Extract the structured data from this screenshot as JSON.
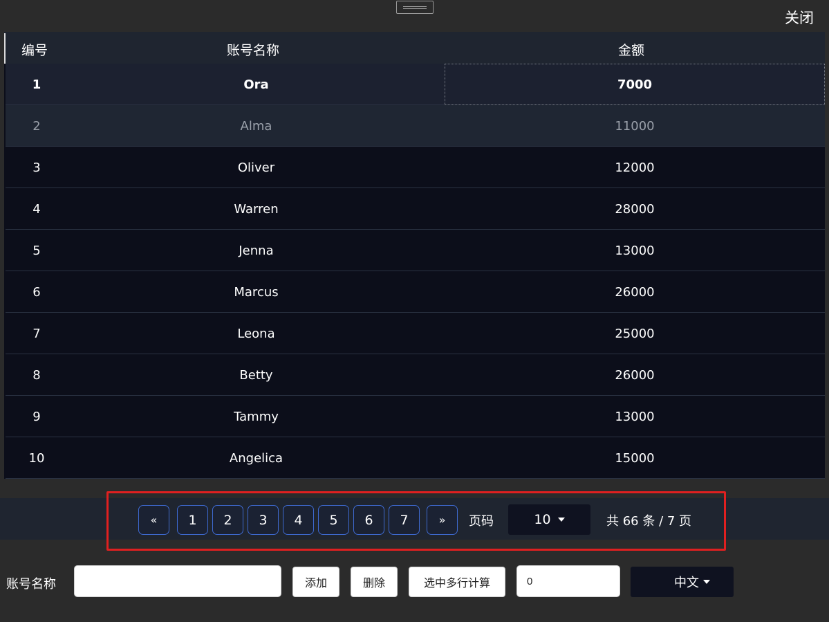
{
  "window": {
    "close_label": "关闭"
  },
  "table": {
    "headers": {
      "id": "编号",
      "name": "账号名称",
      "amount": "金额"
    },
    "rows": [
      {
        "id": "1",
        "name": "Ora",
        "amount": "7000"
      },
      {
        "id": "2",
        "name": "Alma",
        "amount": "11000"
      },
      {
        "id": "3",
        "name": "Oliver",
        "amount": "12000"
      },
      {
        "id": "4",
        "name": "Warren",
        "amount": "28000"
      },
      {
        "id": "5",
        "name": "Jenna",
        "amount": "13000"
      },
      {
        "id": "6",
        "name": "Marcus",
        "amount": "26000"
      },
      {
        "id": "7",
        "name": "Leona",
        "amount": "25000"
      },
      {
        "id": "8",
        "name": "Betty",
        "amount": "26000"
      },
      {
        "id": "9",
        "name": "Tammy",
        "amount": "13000"
      },
      {
        "id": "10",
        "name": "Angelica",
        "amount": "15000"
      }
    ]
  },
  "pagination": {
    "prev": "«",
    "pages": [
      "1",
      "2",
      "3",
      "4",
      "5",
      "6",
      "7"
    ],
    "next": "»",
    "page_label": "页码",
    "page_size": "10",
    "summary": "共 66 条 / 7 页"
  },
  "toolbar": {
    "account_label": "账号名称",
    "account_value": "",
    "add_label": "添加",
    "delete_label": "删除",
    "calc_label": "选中多行计算",
    "result_value": "0",
    "language_label": "中文"
  },
  "colors": {
    "accent_border": "#3e6ad1",
    "highlight_outline": "#e02020",
    "table_bg": "#0c0e1a"
  }
}
